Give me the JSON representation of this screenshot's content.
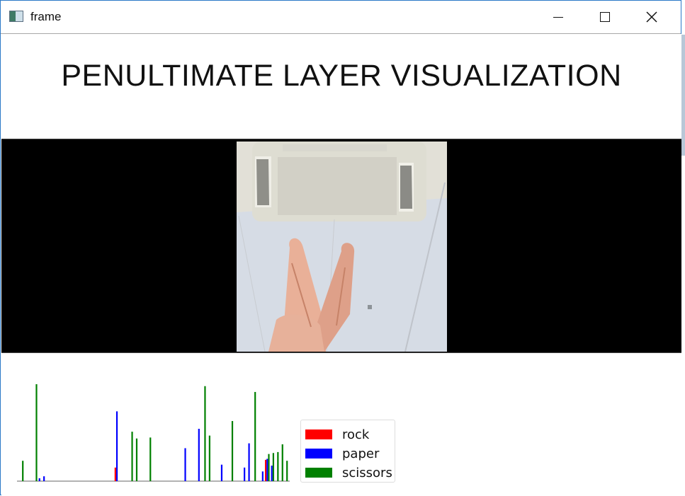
{
  "window": {
    "title": "frame",
    "icon": "app-window-icon",
    "controls": [
      "minimize-icon",
      "maximize-icon",
      "close-icon"
    ]
  },
  "main": {
    "heading": "PENULTIMATE LAYER VISUALIZATION"
  },
  "camera": {
    "icon": "camera-image",
    "description": ""
  },
  "chart_data": {
    "type": "bar",
    "title": "",
    "xlabel": "",
    "ylabel": "",
    "grid": false,
    "legend_position": "right",
    "x": [
      1,
      3,
      4,
      5,
      6,
      7,
      8,
      9,
      10,
      11,
      12,
      13,
      14,
      15,
      16,
      17,
      18,
      19,
      20,
      21,
      22,
      23,
      24,
      25,
      26,
      27,
      28,
      29,
      30,
      31,
      32,
      33,
      34,
      35,
      36,
      37,
      38,
      39,
      40,
      41,
      42,
      43,
      44,
      45,
      46,
      47,
      48,
      49,
      50,
      51,
      52,
      53,
      54,
      55,
      56,
      57,
      58,
      59
    ],
    "series": [
      {
        "name": "rock",
        "color": "#ff0000",
        "values": [
          0,
          0,
          0,
          0,
          0,
          0,
          0,
          0,
          0,
          0,
          0,
          0,
          0,
          0,
          0,
          0,
          0,
          0,
          0,
          0,
          0.14,
          0,
          0,
          0,
          0,
          0,
          0,
          0,
          0,
          0,
          0,
          0,
          0,
          0,
          0,
          0,
          0,
          0,
          0,
          0,
          0,
          0,
          0,
          0,
          0,
          0,
          0,
          0,
          0,
          0,
          0,
          0,
          0,
          0.22,
          0,
          0,
          0,
          0
        ]
      },
      {
        "name": "paper",
        "color": "#0000ff",
        "values": [
          0,
          0,
          0,
          0.03,
          0.05,
          0,
          0,
          0,
          0,
          0,
          0,
          0,
          0,
          0,
          0,
          0,
          0,
          0,
          0,
          0,
          0.72,
          0,
          0,
          0,
          0,
          0,
          0,
          0,
          0,
          0,
          0,
          0,
          0,
          0,
          0,
          0.34,
          0,
          0,
          0.54,
          0,
          0,
          0,
          0,
          0.17,
          0,
          0,
          0,
          0,
          0.14,
          0.39,
          0,
          0,
          0.1,
          0.23,
          0.16,
          0,
          0,
          0
        ]
      },
      {
        "name": "scissors",
        "color": "#008000",
        "values": [
          0.21,
          0,
          1.0,
          0,
          0,
          0,
          0,
          0,
          0,
          0,
          0,
          0,
          0,
          0,
          0,
          0,
          0,
          0,
          0,
          0,
          0,
          0,
          0,
          0.51,
          0.44,
          0,
          0,
          0.45,
          0,
          0,
          0,
          0,
          0,
          0,
          0,
          0,
          0,
          0,
          0,
          0.98,
          0.47,
          0,
          0,
          0,
          0,
          0.62,
          0,
          0,
          0,
          0,
          0.92,
          0,
          0,
          0.28,
          0.29,
          0.3,
          0.38,
          0.21
        ]
      }
    ],
    "ylim": [
      0,
      1
    ]
  }
}
